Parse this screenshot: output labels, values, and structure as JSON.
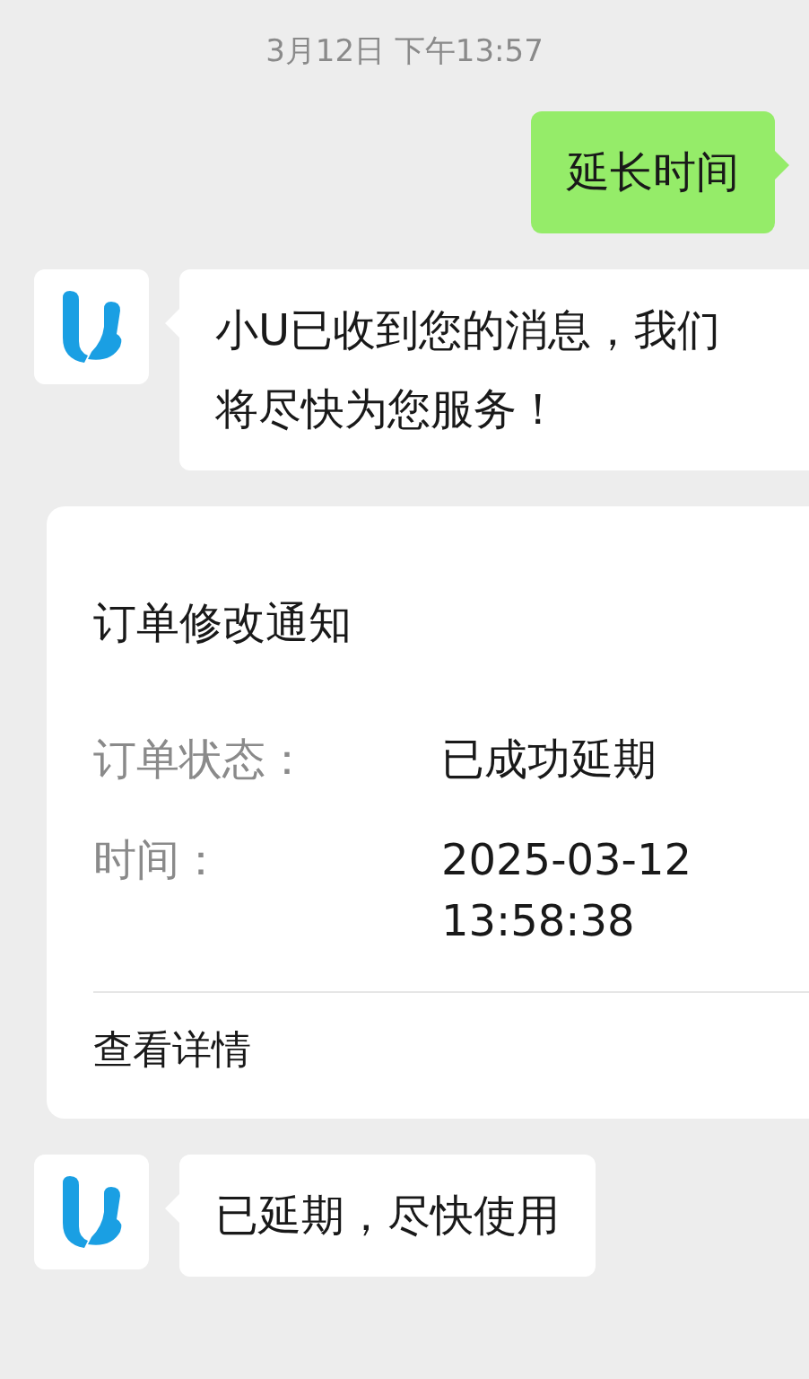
{
  "timestamp": "3月12日 下午13:57",
  "messages": [
    {
      "kind": "sent",
      "text": "延长时间"
    },
    {
      "kind": "received",
      "text": "小U已收到您的消息，我们将尽快为您服务！"
    },
    {
      "kind": "card",
      "title": "订单修改通知",
      "fields": [
        {
          "label": "订单状态：",
          "value": "已成功延期"
        },
        {
          "label": "时间：",
          "value": "2025-03-12 13:58:38"
        }
      ],
      "link": "查看详情"
    },
    {
      "kind": "received",
      "text": "已延期，尽快使用"
    }
  ]
}
